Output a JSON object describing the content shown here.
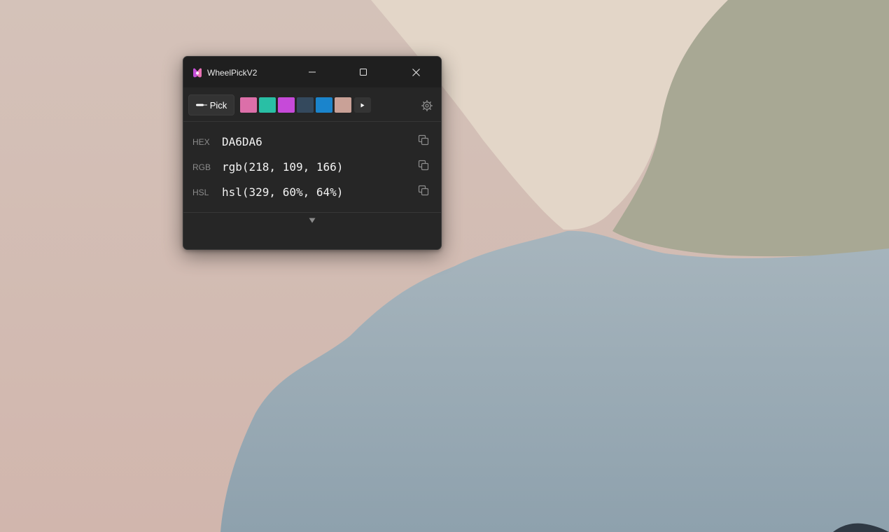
{
  "window": {
    "title": "WheelPickV2",
    "app_icon": "app-logo-icon",
    "caption_icons": [
      "minimize-icon",
      "maximize-icon",
      "close-icon"
    ]
  },
  "toolbar": {
    "pick_label": "Pick",
    "pick_icon": "eyedropper-icon",
    "swatches": [
      {
        "color": "#dc6fa9"
      },
      {
        "color": "#29bfa5"
      },
      {
        "color": "#c64ad9"
      },
      {
        "color": "#34495d"
      },
      {
        "color": "#1a84cc"
      },
      {
        "color": "#c9a197"
      }
    ],
    "more_icon": "play-arrow-icon",
    "settings_icon": "gear-icon"
  },
  "formats": [
    {
      "label": "HEX",
      "value": "DA6DA6",
      "copy_icon": "copy-icon"
    },
    {
      "label": "RGB",
      "value": "rgb(218, 109, 166)",
      "copy_icon": "copy-icon"
    },
    {
      "label": "HSL",
      "value": "hsl(329, 60%, 64%)",
      "copy_icon": "copy-icon"
    }
  ],
  "expand_icon": "chevron-down-icon",
  "colors": {
    "window_bg": "#262626",
    "titlebar_bg": "#1f1f1f",
    "text": "#f2f2f2",
    "muted": "#8c8c8c"
  }
}
